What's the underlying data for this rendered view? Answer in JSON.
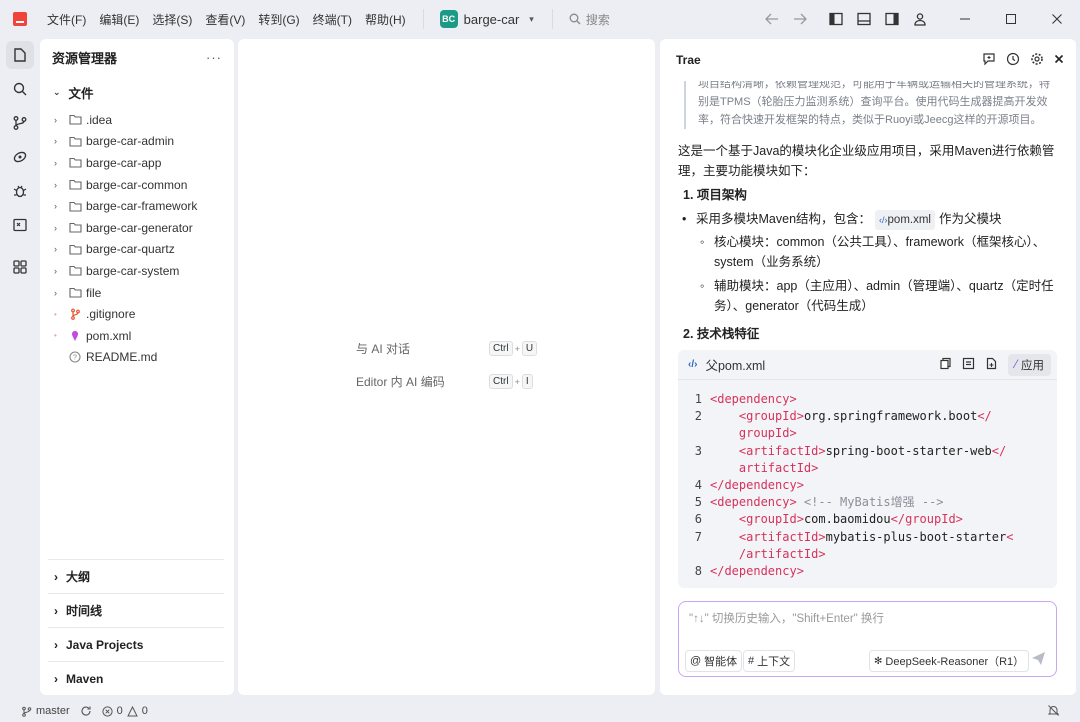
{
  "menu": [
    "文件(F)",
    "编辑(E)",
    "选择(S)",
    "查看(V)",
    "转到(G)",
    "终端(T)",
    "帮助(H)"
  ],
  "project": {
    "badge": "BC",
    "name": "barge-car"
  },
  "search": {
    "label": "搜索"
  },
  "explorer": {
    "title": "资源管理器",
    "more": "···",
    "section": "文件",
    "items": [
      {
        "label": ".idea",
        "type": "folder"
      },
      {
        "label": "barge-car-admin",
        "type": "folder"
      },
      {
        "label": "barge-car-app",
        "type": "folder"
      },
      {
        "label": "barge-car-common",
        "type": "folder"
      },
      {
        "label": "barge-car-framework",
        "type": "folder"
      },
      {
        "label": "barge-car-generator",
        "type": "folder"
      },
      {
        "label": "barge-car-quartz",
        "type": "folder"
      },
      {
        "label": "barge-car-system",
        "type": "folder"
      },
      {
        "label": "file",
        "type": "folder"
      },
      {
        "label": ".gitignore",
        "type": "git"
      },
      {
        "label": "pom.xml",
        "type": "xml"
      },
      {
        "label": "README.md",
        "type": "md"
      }
    ],
    "bottom": [
      "大纲",
      "时间线",
      "Java Projects",
      "Maven"
    ]
  },
  "editor": {
    "shortcuts": [
      {
        "label": "与 AI 对话",
        "keys": [
          "Ctrl",
          "U"
        ]
      },
      {
        "label": "Editor 内 AI 编码",
        "keys": [
          "Ctrl",
          "I"
        ]
      }
    ]
  },
  "trae": {
    "title": "Trae",
    "quote": [
      "项目结构清晰，依赖管理规范，可能用于车辆或运输相关的管理系统，特",
      "别是TPMS（轮胎压力监测系统）查询平台。使用代码生成器提高开发效",
      "率，符合快速开发框架的特点，类似于Ruoyi或Jeecg这样的开源项目。"
    ],
    "intro1": "这是一个基于Java的模块化企业级应用项目，采用Maven进行依赖管",
    "intro2": "理，主要功能模块如下：",
    "h1": "1. 项目架构",
    "b1_pre": "采用多模块Maven结构，包含：",
    "b1_code": "pom.xml",
    "b1_post": "作为父模块",
    "s1a": "核心模块：common（公共工具）、framework（框架核心）、",
    "s1b": "system（业务系统）",
    "s2a": "辅助模块：app（主应用）、admin（管理端）、quartz（定时任",
    "s2b": "务）、generator（代码生成）",
    "h2": "2. 技术栈特征",
    "codeblock": {
      "title": "父pom.xml",
      "apply": "应用",
      "lines": [
        {
          "n": "1",
          "parts": [
            [
              "tag",
              "<dependency>"
            ]
          ]
        },
        {
          "n": "2",
          "parts": [
            [
              "sp",
              "    "
            ],
            [
              "tag",
              "<groupId>"
            ],
            [
              "txt",
              "org.springframework.boot"
            ],
            [
              "tag",
              "</"
            ]
          ]
        },
        {
          "n": "",
          "parts": [
            [
              "sp",
              "    "
            ],
            [
              "tag",
              "groupId>"
            ]
          ]
        },
        {
          "n": "3",
          "parts": [
            [
              "sp",
              "    "
            ],
            [
              "tag",
              "<artifactId>"
            ],
            [
              "txt",
              "spring-boot-starter-web"
            ],
            [
              "tag",
              "</"
            ]
          ]
        },
        {
          "n": "",
          "parts": [
            [
              "sp",
              "    "
            ],
            [
              "tag",
              "artifactId>"
            ]
          ]
        },
        {
          "n": "4",
          "parts": [
            [
              "tag",
              "</dependency>"
            ]
          ]
        },
        {
          "n": "5",
          "parts": [
            [
              "tag",
              "<dependency>"
            ],
            [
              "cmt",
              " <!-- MyBatis增强 -->"
            ]
          ]
        },
        {
          "n": "6",
          "parts": [
            [
              "sp",
              "    "
            ],
            [
              "tag",
              "<groupId>"
            ],
            [
              "txt",
              "com.baomidou"
            ],
            [
              "tag",
              "</groupId>"
            ]
          ]
        },
        {
          "n": "7",
          "parts": [
            [
              "sp",
              "    "
            ],
            [
              "tag",
              "<artifactId>"
            ],
            [
              "txt",
              "mybatis-plus-boot-starter"
            ],
            [
              "tag",
              "<"
            ]
          ]
        },
        {
          "n": "",
          "parts": [
            [
              "sp",
              "    "
            ],
            [
              "tag",
              "/artifactId>"
            ]
          ]
        },
        {
          "n": "8",
          "parts": [
            [
              "tag",
              "</dependency>"
            ]
          ]
        }
      ]
    },
    "chat": {
      "placeholder": "\"↑↓\" 切换历史输入，\"Shift+Enter\" 换行",
      "agent": "智能体",
      "context": "上下文",
      "model": "DeepSeek-Reasoner（R1）"
    }
  },
  "status": {
    "branch": "master",
    "errors": "0",
    "warnings": "0"
  }
}
